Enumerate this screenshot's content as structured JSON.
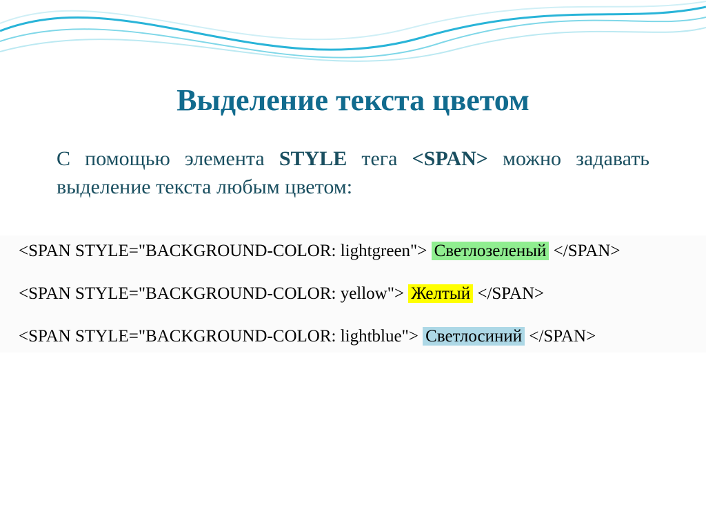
{
  "title": "Выделение текста цветом",
  "intro_parts": {
    "p1": "С помощью элемента ",
    "s_style": "STYLE",
    "p2": " тега ",
    "s_span": "<SPAN>",
    "p3": " можно задавать выделение текста любым цветом:"
  },
  "examples": [
    {
      "open": "<SPAN STYLE=\"BACKGROUND-COLOR: lightgreen\"> ",
      "text": "Светлозеленый",
      "close": " </SPAN>",
      "hlclass": "hl-green"
    },
    {
      "open": "<SPAN STYLE=\"BACKGROUND-COLOR: yellow\"> ",
      "text": "Желтый",
      "close": " </SPAN>",
      "hlclass": "hl-yellow"
    },
    {
      "open": "<SPAN STYLE=\"BACKGROUND-COLOR: lightblue\"> ",
      "text": "Светлосиний",
      "close": " </SPAN>",
      "hlclass": "hl-blue"
    }
  ],
  "colors": {
    "title": "#116b8e",
    "body": "#1a4f60",
    "hl_green": "#90ee90",
    "hl_yellow": "#ffff00",
    "hl_blue": "#add8e6"
  }
}
